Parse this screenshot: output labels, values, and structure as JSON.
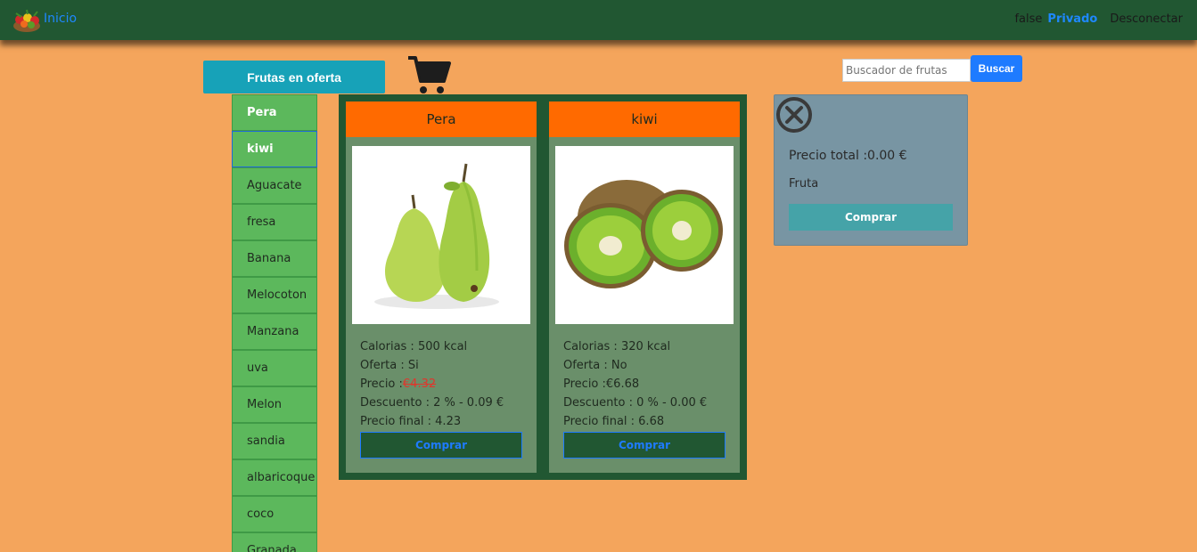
{
  "navbar": {
    "brand": "Inicio",
    "logo_icon": "fruit-basket-icon",
    "status": "false",
    "private": "Privado",
    "logout": "Desconectar"
  },
  "toolbar": {
    "offers_label": "Frutas en oferta",
    "cart_icon": "shopping-cart-icon"
  },
  "search": {
    "placeholder": "Buscador de frutas",
    "button": "Buscar"
  },
  "sidebar": {
    "items": [
      {
        "label": "Pera"
      },
      {
        "label": "kiwi"
      },
      {
        "label": "Aguacate"
      },
      {
        "label": "fresa"
      },
      {
        "label": "Banana"
      },
      {
        "label": "Melocoton"
      },
      {
        "label": "Manzana"
      },
      {
        "label": "uva"
      },
      {
        "label": "Melon"
      },
      {
        "label": "sandia"
      },
      {
        "label": "albaricoque"
      },
      {
        "label": "coco"
      },
      {
        "label": "Granada"
      }
    ]
  },
  "products": [
    {
      "name": "Pera",
      "calories": "Calorias : 500 kcal",
      "offer": "Oferta : Si",
      "price_label": "Precio :",
      "price_value": "€4.32",
      "discount": "Descuento : 2 % - 0.09 €",
      "final_price": "Precio final : 4.23",
      "buy": "Comprar"
    },
    {
      "name": "kiwi",
      "calories": "Calorias : 320 kcal",
      "offer": "Oferta : No",
      "price_label": "Precio :",
      "price_value": "€6.68",
      "discount": "Descuento : 0 % - 0.00 €",
      "final_price": "Precio final : 6.68",
      "buy": "Comprar"
    }
  ],
  "cart": {
    "total": "Precio total :0.00 €",
    "fruit_label": "Fruta",
    "buy": "Comprar"
  },
  "colors": {
    "background": "#f4a55c",
    "navbar": "#215732",
    "brand_link": "#1e88ff",
    "offers_button": "#17a2b8",
    "sidebar_item": "#5cb85c",
    "card_header": "#ff6a00",
    "card_body": "#6a8f6a",
    "cart_panel": "#7895a3",
    "discounted_price": "#e0362c"
  }
}
